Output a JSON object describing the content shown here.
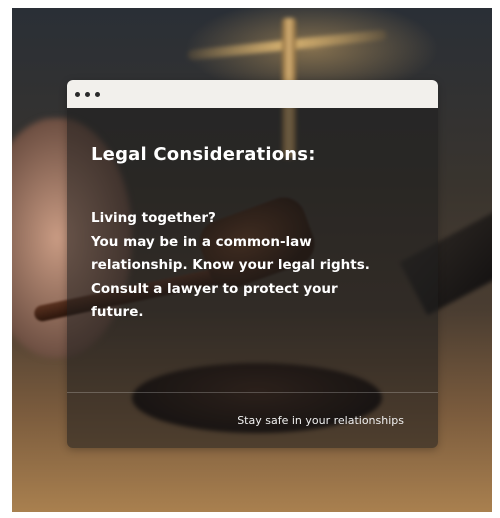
{
  "card": {
    "title": "Legal Considerations:",
    "lines": [
      "Living together?",
      "You may be in a common-law",
      "relationship. Know your legal rights.",
      "Consult a lawyer to protect your",
      "future."
    ],
    "footer": "Stay safe in your relationships"
  },
  "background": {
    "description_icon": "gavel-and-scales-photo"
  },
  "colors": {
    "bar": "#f2f0ec",
    "dot": "#2a2a2a",
    "text": "#ffffff"
  }
}
